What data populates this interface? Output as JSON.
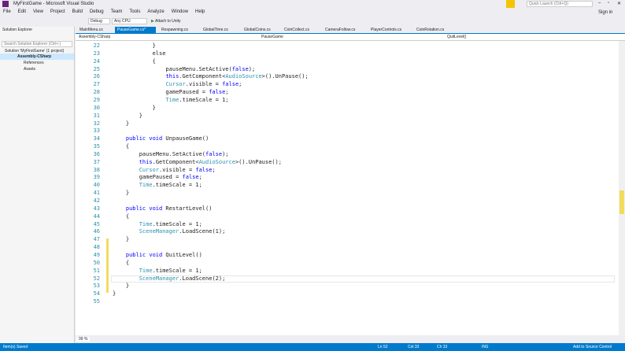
{
  "title": "MyFirstGame - Microsoft Visual Studio",
  "menu": [
    "File",
    "Edit",
    "View",
    "Project",
    "Build",
    "Debug",
    "Team",
    "Tools",
    "Analyze",
    "Window",
    "Help"
  ],
  "toolbar": {
    "config": "Debug",
    "platform": "Any CPU",
    "attach": "Attach to Unity"
  },
  "quick_launch": "Quick Launch (Ctrl+Q)",
  "sign_in": "Sign in",
  "solution_explorer": {
    "title": "Solution Explorer",
    "search": "Search Solution Explorer (Ctrl+;)",
    "items": [
      "Solution 'MyFirstGame' (1 project)",
      "Assembly-CSharp",
      "References",
      "Assets"
    ]
  },
  "tabs": [
    "MainMenu.cs",
    "PauseGame.cs*",
    "Respawning.cs",
    "GlobalTime.cs",
    "GlobalCoins.cs",
    "CoinCollect.cs",
    "CameraFollow.cs",
    "PlayerControls.cs",
    "CoinRotation.cs"
  ],
  "nav": {
    "project": "Assembly-CSharp",
    "class": "PauseGame",
    "member": "QuitLevel()"
  },
  "zoom": "99 %",
  "status": {
    "message": "Item(s) Saved",
    "ln": "Ln 52",
    "col": "Col 33",
    "ch": "Ch 33",
    "mode": "INS",
    "source_control": "Add to Source Control"
  },
  "code": [
    {
      "n": "22",
      "t": [
        [
          "            }",
          ""
        ]
      ]
    },
    {
      "n": "23",
      "t": [
        [
          "            else",
          ""
        ]
      ]
    },
    {
      "n": "24",
      "t": [
        [
          "            {",
          ""
        ]
      ]
    },
    {
      "n": "25",
      "t": [
        [
          "                pauseMenu.SetActive(",
          ""
        ],
        [
          "false",
          "kw"
        ],
        [
          ");",
          ""
        ]
      ]
    },
    {
      "n": "26",
      "t": [
        [
          "                ",
          ""
        ],
        [
          "this",
          "kw"
        ],
        [
          ".GetComponent<",
          ""
        ],
        [
          "AudioSource",
          "ty"
        ],
        [
          ">().UnPause();",
          ""
        ]
      ]
    },
    {
      "n": "27",
      "t": [
        [
          "                ",
          ""
        ],
        [
          "Cursor",
          "ty"
        ],
        [
          ".visible = ",
          ""
        ],
        [
          "false",
          "kw"
        ],
        [
          ";",
          ""
        ]
      ]
    },
    {
      "n": "28",
      "t": [
        [
          "                gamePaused = ",
          ""
        ],
        [
          "false",
          "kw"
        ],
        [
          ";",
          ""
        ]
      ]
    },
    {
      "n": "29",
      "t": [
        [
          "                ",
          ""
        ],
        [
          "Time",
          "ty"
        ],
        [
          ".timeScale = 1;",
          ""
        ]
      ]
    },
    {
      "n": "30",
      "t": [
        [
          "            }",
          ""
        ]
      ]
    },
    {
      "n": "31",
      "t": [
        [
          "        }",
          ""
        ]
      ]
    },
    {
      "n": "32",
      "t": [
        [
          "    }",
          ""
        ]
      ]
    },
    {
      "n": "33",
      "t": []
    },
    {
      "n": "34",
      "t": [
        [
          "    ",
          ""
        ],
        [
          "public void",
          "kw"
        ],
        [
          " UnpauseGame()",
          ""
        ]
      ]
    },
    {
      "n": "35",
      "t": [
        [
          "    {",
          ""
        ]
      ]
    },
    {
      "n": "36",
      "t": [
        [
          "        pauseMenu.SetActive(",
          ""
        ],
        [
          "false",
          "kw"
        ],
        [
          ");",
          ""
        ]
      ]
    },
    {
      "n": "37",
      "t": [
        [
          "        ",
          ""
        ],
        [
          "this",
          "kw"
        ],
        [
          ".GetComponent<",
          ""
        ],
        [
          "AudioSource",
          "ty"
        ],
        [
          ">().UnPause();",
          ""
        ]
      ]
    },
    {
      "n": "38",
      "t": [
        [
          "        ",
          ""
        ],
        [
          "Cursor",
          "ty"
        ],
        [
          ".visible = ",
          ""
        ],
        [
          "false",
          "kw"
        ],
        [
          ";",
          ""
        ]
      ]
    },
    {
      "n": "39",
      "t": [
        [
          "        gamePaused = ",
          ""
        ],
        [
          "false",
          "kw"
        ],
        [
          ";",
          ""
        ]
      ]
    },
    {
      "n": "40",
      "t": [
        [
          "        ",
          ""
        ],
        [
          "Time",
          "ty"
        ],
        [
          ".timeScale = 1;",
          ""
        ]
      ]
    },
    {
      "n": "41",
      "t": [
        [
          "    }",
          ""
        ]
      ]
    },
    {
      "n": "42",
      "t": []
    },
    {
      "n": "43",
      "t": [
        [
          "    ",
          ""
        ],
        [
          "public void",
          "kw"
        ],
        [
          " RestartLevel()",
          ""
        ]
      ]
    },
    {
      "n": "44",
      "t": [
        [
          "    {",
          ""
        ]
      ]
    },
    {
      "n": "45",
      "t": [
        [
          "        ",
          ""
        ],
        [
          "Time",
          "ty"
        ],
        [
          ".timeScale = 1;",
          ""
        ]
      ]
    },
    {
      "n": "46",
      "t": [
        [
          "        ",
          ""
        ],
        [
          "SceneManager",
          "ty"
        ],
        [
          ".LoadScene(1);",
          ""
        ]
      ]
    },
    {
      "n": "47",
      "t": [
        [
          "    }",
          ""
        ]
      ]
    },
    {
      "n": "48",
      "t": []
    },
    {
      "n": "49",
      "t": [
        [
          "    ",
          ""
        ],
        [
          "public void",
          "kw"
        ],
        [
          " QuitLevel()",
          ""
        ]
      ]
    },
    {
      "n": "50",
      "t": [
        [
          "    {",
          ""
        ]
      ]
    },
    {
      "n": "51",
      "t": [
        [
          "        ",
          ""
        ],
        [
          "Time",
          "ty"
        ],
        [
          ".timeScale = 1;",
          ""
        ]
      ]
    },
    {
      "n": "52",
      "t": [
        [
          "        ",
          ""
        ],
        [
          "SceneManager",
          "ty"
        ],
        [
          ".LoadScene(2);",
          ""
        ]
      ]
    },
    {
      "n": "53",
      "t": [
        [
          "    }",
          ""
        ]
      ]
    },
    {
      "n": "54",
      "t": [
        [
          "}",
          ""
        ]
      ]
    },
    {
      "n": "55",
      "t": []
    }
  ],
  "colors": {
    "accent": "#007acc",
    "keyword": "#0000ff",
    "type": "#2b91af"
  }
}
